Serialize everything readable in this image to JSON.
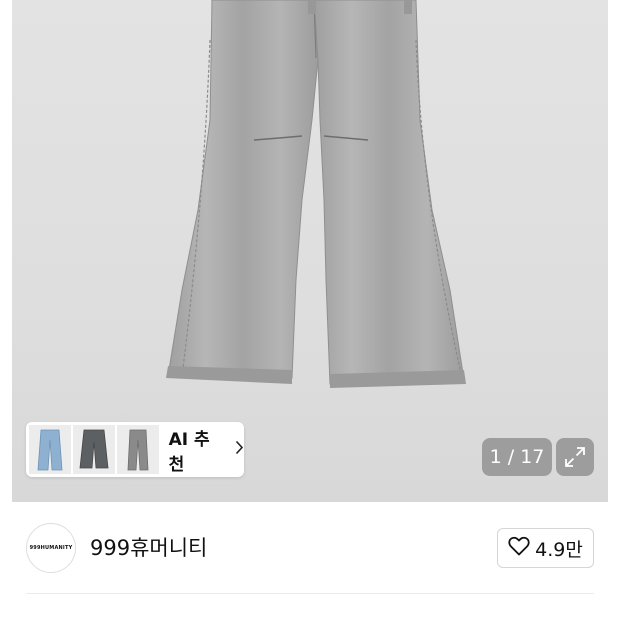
{
  "gallery": {
    "thumbnails": [
      {
        "icon": "jeans-light-blue",
        "color": "#8eb0d1"
      },
      {
        "icon": "jeans-dark-gray",
        "color": "#5d6063"
      },
      {
        "icon": "jeans-gray",
        "color": "#8a8a8a"
      }
    ],
    "ai_recommend_label": "AI 추천",
    "ai_recommend_icon": "chevron-right-icon",
    "counter": "1 / 17",
    "expand_icon": "expand-icon",
    "product_color": "#a9a9a9"
  },
  "seller": {
    "logo_text": "999HUMANITY",
    "name": "999휴머니티",
    "like_icon": "heart-outline-icon",
    "like_count": "4.9만"
  }
}
